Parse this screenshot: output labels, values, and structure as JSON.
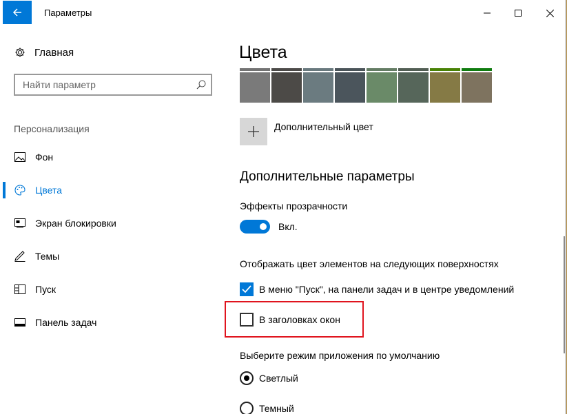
{
  "window": {
    "title": "Параметры",
    "back_icon": "arrow-left-icon",
    "accent": "#0078d7"
  },
  "sidebar": {
    "home_label": "Главная",
    "search_placeholder": "Найти параметр",
    "section_label": "Персонализация",
    "items": [
      {
        "label": "Фон",
        "icon": "picture-icon",
        "active": false
      },
      {
        "label": "Цвета",
        "icon": "palette-icon",
        "active": true
      },
      {
        "label": "Экран блокировки",
        "icon": "lock-screen-icon",
        "active": false
      },
      {
        "label": "Темы",
        "icon": "brush-icon",
        "active": false
      },
      {
        "label": "Пуск",
        "icon": "start-icon",
        "active": false
      },
      {
        "label": "Панель задач",
        "icon": "taskbar-icon",
        "active": false
      }
    ]
  },
  "main": {
    "title": "Цвета",
    "swatches": [
      {
        "bar": "#737373",
        "fill": "#7a7a7a"
      },
      {
        "bar": "#4c4a48",
        "fill": "#4c4a47"
      },
      {
        "bar": "#69797e",
        "fill": "#6b7b80"
      },
      {
        "bar": "#4a5459",
        "fill": "#4b555c"
      },
      {
        "bar": "#647c64",
        "fill": "#6a8a68"
      },
      {
        "bar": "#525e54",
        "fill": "#56665a"
      },
      {
        "bar": "#498205",
        "fill": "#857a45"
      },
      {
        "bar": "#107c10",
        "fill": "#7e735f"
      }
    ],
    "add_color_label": "Дополнительный цвет",
    "advanced_title": "Дополнительные параметры",
    "transparency_label": "Эффекты прозрачности",
    "transparency_state": "Вкл.",
    "surfaces_label": "Отображать цвет элементов на следующих поверхностях",
    "start_taskbar_label": "В меню \"Пуск\", на панели задач и в центре уведомлений",
    "start_taskbar_checked": true,
    "title_bars_label": "В заголовках окон",
    "title_bars_checked": false,
    "app_mode_label": "Выберите режим приложения по умолчанию",
    "mode_light": "Светлый",
    "mode_dark": "Темный",
    "selected_mode": "Светлый"
  }
}
